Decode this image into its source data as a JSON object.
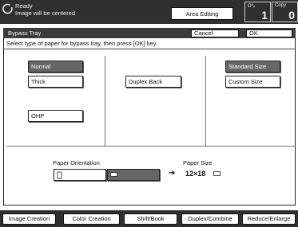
{
  "status": {
    "line1": "Ready",
    "line2": "Image will be centered",
    "area_editing": "Area Editing",
    "originals_label": "O⁰ᵥ",
    "originals_count": "1",
    "copies_label": "Copy",
    "copies_count": "0"
  },
  "dialog": {
    "title": "Bypass Tray",
    "cancel": "Cancel",
    "ok": "OK",
    "instruction": "Select type of paper for bypass tray, then press [OK] key."
  },
  "paper_types": {
    "normal": "Normal",
    "thick": "Thick",
    "ohp": "OHP",
    "duplex_back": "Duplex Back",
    "standard_size": "Standard Size",
    "custom_size": "Custom Size",
    "selected": [
      "Normal",
      "Standard Size"
    ]
  },
  "orientation": {
    "label": "Paper Orientation",
    "selected": "landscape"
  },
  "paper_size": {
    "label": "Paper Size",
    "value": "12×18"
  },
  "tabs": [
    "Image Creation",
    "Color Creation",
    "Shift/Book",
    "Duplex/Combine",
    "Reduce/Enlarge"
  ]
}
